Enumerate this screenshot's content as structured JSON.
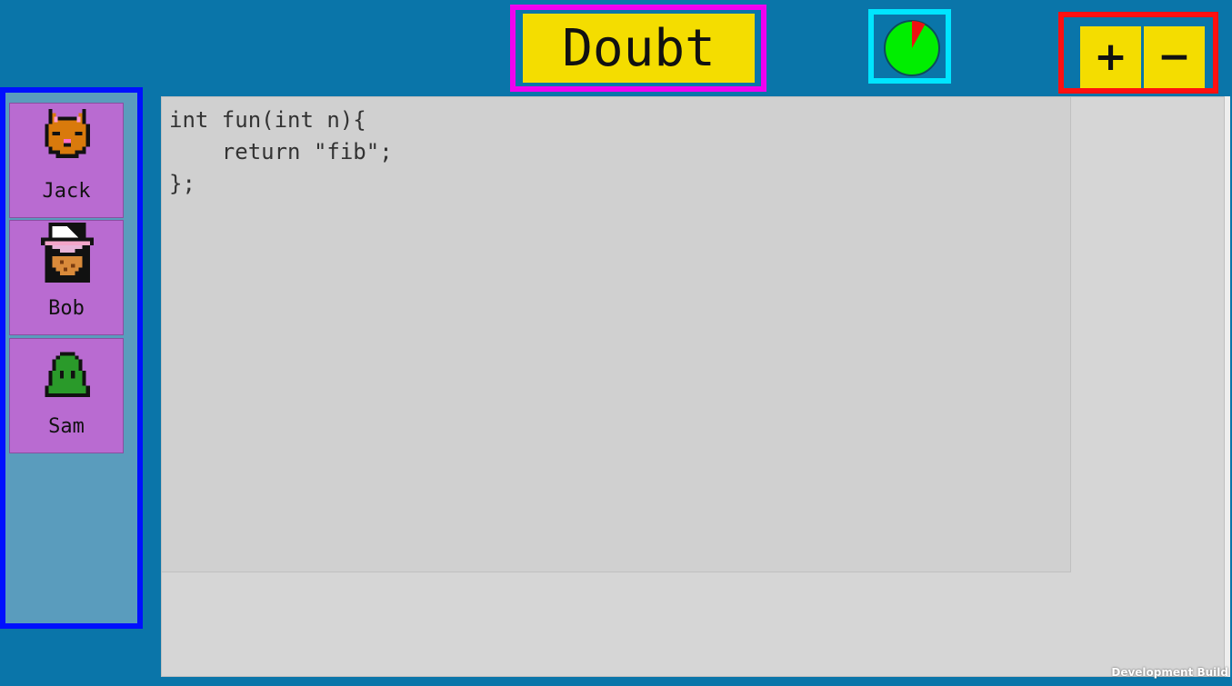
{
  "doubt_button": {
    "label": "Doubt"
  },
  "timer": {
    "remaining_fraction": 0.92,
    "colors": {
      "remaining": "#00ee00",
      "elapsed": "#ee1111"
    }
  },
  "zoom": {
    "plus_label": "+",
    "minus_label": "−"
  },
  "players": [
    {
      "name": "Jack",
      "avatar": "cat-avatar-icon"
    },
    {
      "name": "Bob",
      "avatar": "bearded-man-avatar-icon"
    },
    {
      "name": "Sam",
      "avatar": "green-slime-avatar-icon"
    }
  ],
  "editor": {
    "code": "int fun(int n){\n    return \"fib\";\n};"
  },
  "footer": {
    "build_label": "Development Build"
  },
  "colors": {
    "background": "#0a75a9",
    "button_yellow": "#f4dd00",
    "player_card": "#b96bd1",
    "highlight_magenta": "#f000f0",
    "highlight_cyan": "#00e5ff",
    "highlight_red": "#ff1010",
    "highlight_blue": "#0010ff"
  }
}
